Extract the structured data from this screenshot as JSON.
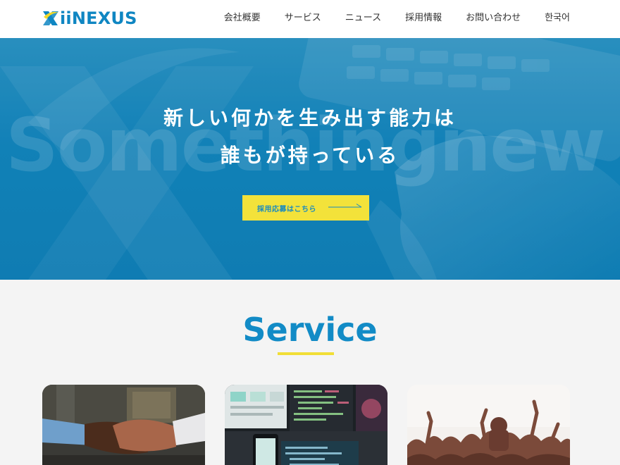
{
  "header": {
    "logo_text": "iiNEXUS",
    "nav": [
      {
        "label": "会社概要"
      },
      {
        "label": "サービス"
      },
      {
        "label": "ニュース"
      },
      {
        "label": "採用情報"
      },
      {
        "label": "お問い合わせ"
      },
      {
        "label": "한국어"
      }
    ]
  },
  "hero": {
    "watermark": "Somethingnew",
    "headline_line1": "新しい何かを生み出す能力は",
    "headline_line2": "誰もが持っている",
    "cta_label": "採用応募はこちら",
    "cta_color": "#f3e23a"
  },
  "service": {
    "title": "Service",
    "accent_color": "#128bc6",
    "underline_color": "#f1de36",
    "cards": [
      {
        "image": "handshake-photo"
      },
      {
        "image": "developer-screens-photo"
      },
      {
        "image": "concert-crowd-photo"
      }
    ]
  }
}
